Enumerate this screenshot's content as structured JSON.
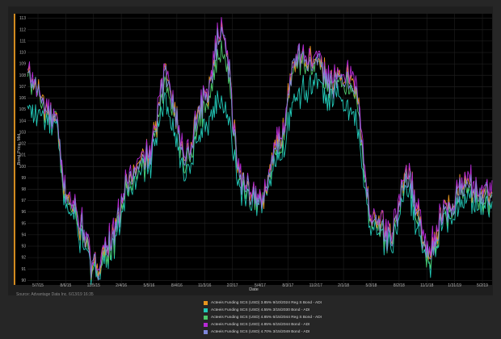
{
  "source_text": "Source: Advantage Data Inc. 6/13/19 16:35",
  "chart_data": {
    "type": "line",
    "title": "",
    "xlabel": "Date",
    "ylabel": "Bond Price: Mid",
    "ylim": [
      89.6,
      113.4
    ],
    "yticks": [
      90,
      91,
      92,
      93,
      94,
      95,
      96,
      97,
      98,
      99,
      100,
      101,
      102,
      103,
      104,
      105,
      106,
      107,
      108,
      109,
      110,
      111,
      112,
      113
    ],
    "xtick_labels": [
      "5/7/15",
      "8/6/15",
      "11/5/15",
      "2/4/16",
      "5/5/16",
      "8/4/16",
      "11/3/16",
      "2/2/17",
      "5/4/17",
      "8/3/17",
      "11/2/17",
      "2/1/18",
      "5/3/18",
      "8/2/18",
      "11/1/18",
      "1/31/19",
      "5/2/19"
    ],
    "x_range": [
      0,
      50
    ],
    "grid": true,
    "legend_placement": "bottom",
    "x_anchor_index": [
      0,
      3,
      4,
      6,
      7,
      9,
      11,
      13,
      15,
      17,
      19,
      21,
      23,
      25,
      27,
      29,
      31,
      33,
      35,
      37,
      39,
      41,
      42,
      43,
      45,
      47,
      50
    ],
    "series": [
      {
        "name": "Acteeis Funding SCS (USD) 3.85% 9/10/2024 Reg S Bond - ADI",
        "color": "#e8961e",
        "values": [
          108.0,
          104.0,
          98.0,
          94.5,
          91.0,
          93.5,
          99.0,
          101.0,
          108.0,
          101.0,
          106.0,
          112.0,
          99.0,
          97.0,
          102.0,
          110.0,
          109.0,
          107.5,
          108.0,
          96.0,
          94.0,
          99.5,
          96.0,
          92.5,
          96.0,
          98.5,
          97.5
        ]
      },
      {
        "name": "Acteeis Funding SCS (USD) 4.55% 3/15/2030 Bond - ADI",
        "color": "#22c9b8",
        "values": [
          105.0,
          103.5,
          97.0,
          93.5,
          90.5,
          92.5,
          98.0,
          100.0,
          105.5,
          99.5,
          103.5,
          106.0,
          98.0,
          96.5,
          100.5,
          106.5,
          107.0,
          106.0,
          105.0,
          95.0,
          93.0,
          98.0,
          94.5,
          91.5,
          95.0,
          97.0,
          96.5
        ]
      },
      {
        "name": "Acteeis Funding SCS (USD) 4.85% 6/15/2044 Reg S Bond - ADI",
        "color": "#4cc86a",
        "values": [
          107.5,
          104.0,
          97.5,
          94.0,
          90.8,
          93.0,
          98.5,
          100.5,
          107.0,
          100.5,
          105.0,
          110.5,
          98.5,
          96.8,
          101.5,
          109.5,
          108.5,
          107.0,
          107.0,
          95.5,
          93.5,
          99.0,
          95.5,
          92.0,
          95.5,
          97.8,
          97.0
        ]
      },
      {
        "name": "Acteeis Funding SCS (USD) 4.85% 6/15/2044 Bond - ADI",
        "color": "#b82ad6",
        "values": [
          108.0,
          104.2,
          98.2,
          94.8,
          91.2,
          93.8,
          99.2,
          101.2,
          108.2,
          101.2,
          106.2,
          112.2,
          99.2,
          97.2,
          102.2,
          110.2,
          109.2,
          107.8,
          108.4,
          96.2,
          94.2,
          99.8,
          96.4,
          92.8,
          96.2,
          98.8,
          97.8
        ]
      },
      {
        "name": "Acteeis Funding SCS (USD) 4.70% 3/15/2049 Bond - ADI",
        "color": "#7f86d9",
        "values": [
          107.8,
          104.0,
          98.0,
          94.4,
          90.8,
          93.4,
          98.8,
          100.8,
          107.8,
          100.8,
          105.8,
          112.0,
          98.8,
          96.8,
          101.8,
          110.0,
          108.8,
          107.2,
          107.6,
          95.8,
          93.8,
          99.2,
          95.8,
          92.2,
          95.8,
          98.2,
          97.2
        ]
      }
    ]
  }
}
